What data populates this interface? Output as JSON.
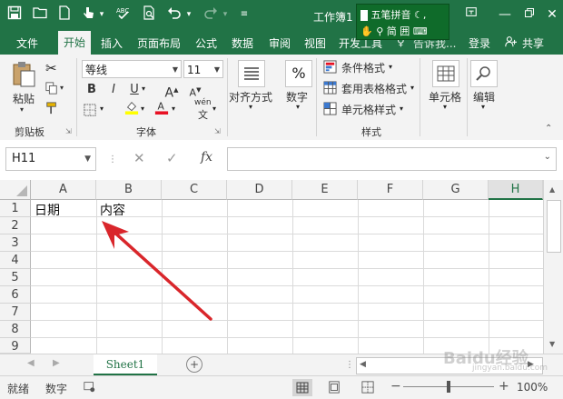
{
  "window": {
    "title": "工作簿1"
  },
  "ime": {
    "name": "五笔拼音",
    "mode": "简",
    "mode2": "囲"
  },
  "menu": {
    "file": "文件",
    "home": "开始",
    "insert": "插入",
    "layout": "页面布局",
    "formulas": "公式",
    "data": "数据",
    "review": "审阅",
    "view": "视图",
    "developer": "开发工具",
    "tell_me": "告诉我...",
    "login": "登录",
    "share": "共享"
  },
  "ribbon": {
    "paste": "粘贴",
    "clipboard": "剪贴板",
    "font_name": "等线",
    "font_size": "11",
    "font_group": "字体",
    "phonetic": "wén",
    "alignment": "对齐方式",
    "number": "数字",
    "number_symbol": "%",
    "cond_format": "条件格式",
    "table_format": "套用表格格式",
    "cell_style": "单元格样式",
    "styles_group": "样式",
    "cells": "单元格",
    "editing": "编辑"
  },
  "formula_bar": {
    "name_box": "H11",
    "fx": "fx",
    "value": ""
  },
  "grid": {
    "columns": [
      "A",
      "B",
      "C",
      "D",
      "E",
      "F",
      "G",
      "H"
    ],
    "rows": [
      "1",
      "2",
      "3",
      "4",
      "5",
      "6",
      "7",
      "8",
      "9"
    ],
    "cells": {
      "A1": "日期",
      "B1": "内容"
    }
  },
  "sheet": {
    "name": "Sheet1"
  },
  "status": {
    "ready": "就绪",
    "numlock": "数字",
    "zoom": "100%",
    "watermark": "Baidu经验",
    "watermark_url": "jingyan.baidu.com"
  },
  "colors": {
    "accent": "#217346",
    "arrow": "#d9262b"
  }
}
